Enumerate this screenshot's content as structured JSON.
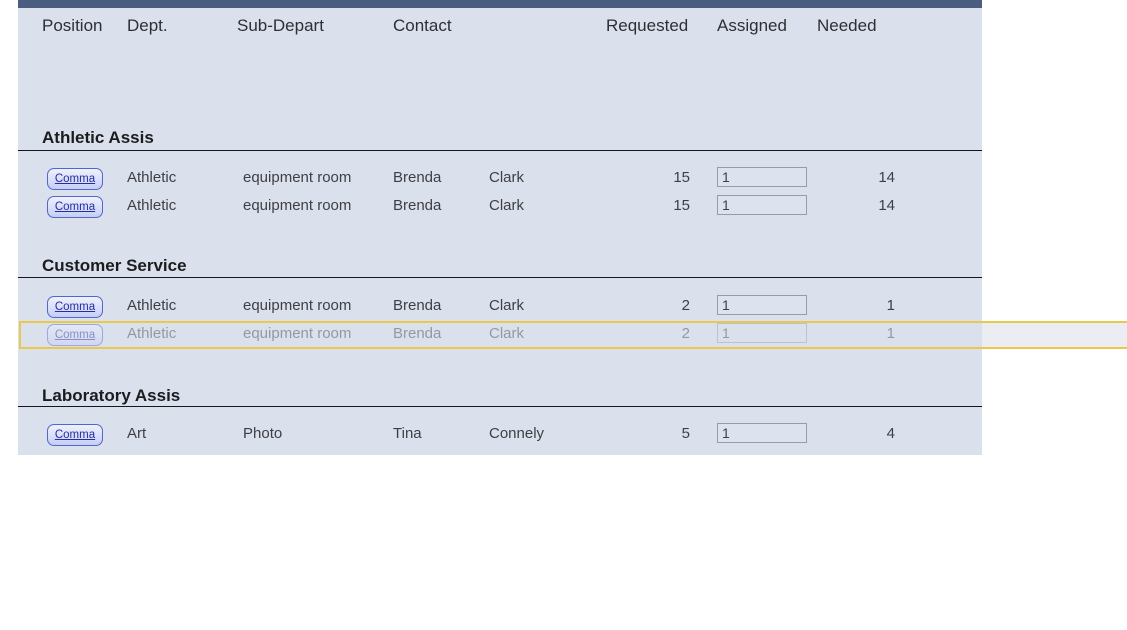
{
  "header": {
    "position": "Position",
    "dept": "Dept.",
    "sub_depart": "Sub-Depart",
    "contact": "Contact",
    "requested": "Requested",
    "assigned": "Assigned",
    "needed": "Needed"
  },
  "groups": [
    {
      "title": "Athletic Assis",
      "rows": [
        {
          "button_label": "Comma",
          "dept": "Athletic",
          "sub_depart": "equipment room",
          "contact_first": "Brenda",
          "contact_last": "Clark",
          "requested": "15",
          "assigned_value": "1",
          "needed": "14",
          "state": "normal"
        },
        {
          "button_label": "Comma",
          "dept": "Athletic",
          "sub_depart": "equipment room",
          "contact_first": "Brenda",
          "contact_last": "Clark",
          "requested": "15",
          "assigned_value": "1",
          "needed": "14",
          "state": "normal"
        }
      ]
    },
    {
      "title": "Customer Service",
      "rows": [
        {
          "button_label": "Comma",
          "dept": "Athletic",
          "sub_depart": "equipment room",
          "contact_first": "Brenda",
          "contact_last": "Clark",
          "requested": "2",
          "assigned_value": "1",
          "needed": "1",
          "state": "normal"
        },
        {
          "button_label": "Comma",
          "dept": "Athletic",
          "sub_depart": "equipment room",
          "contact_first": "Brenda",
          "contact_last": "Clark",
          "requested": "2",
          "assigned_value": "1",
          "needed": "1",
          "state": "faded-highlighted"
        }
      ]
    },
    {
      "title": "Laboratory Assis",
      "rows": [
        {
          "button_label": "Comma",
          "dept": "Art",
          "sub_depart": "Photo",
          "contact_first": "Tina",
          "contact_last": "Connely",
          "requested": "5",
          "assigned_value": "1",
          "needed": "4",
          "state": "normal"
        }
      ]
    }
  ],
  "colors": {
    "top_bar": "#4a5c80",
    "report_background": "#dbe0ed",
    "group_line": "#17171a",
    "highlight_border": "#e9c94c",
    "highlight_fill_right": "#ebedf3",
    "button_border": "#4f68c9",
    "button_text": "#242f9b"
  }
}
